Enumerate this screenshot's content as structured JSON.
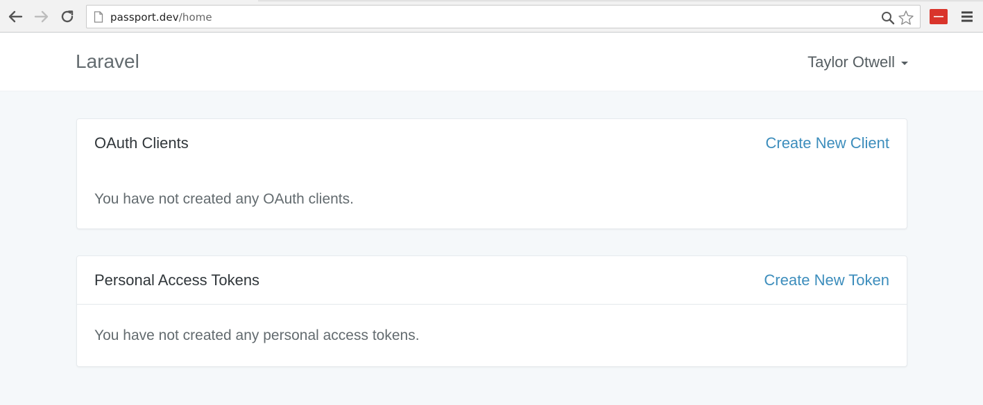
{
  "browser": {
    "url_host": "passport.dev",
    "url_path": "/home",
    "icons": [
      "back-icon",
      "forward-icon",
      "reload-icon",
      "page-icon",
      "zoom-icon",
      "star-icon",
      "extension-icon",
      "menu-icon"
    ]
  },
  "navbar": {
    "brand": "Laravel",
    "user_name": "Taylor Otwell"
  },
  "panels": [
    {
      "title": "OAuth Clients",
      "action": "Create New Client",
      "empty_message": "You have not created any OAuth clients."
    },
    {
      "title": "Personal Access Tokens",
      "action": "Create New Token",
      "empty_message": "You have not created any personal access tokens."
    }
  ],
  "colors": {
    "page_background": "#f5f8fa",
    "link": "#3c8dbc",
    "brand_text": "#636b6f",
    "extension_badge": "#d9342b"
  }
}
